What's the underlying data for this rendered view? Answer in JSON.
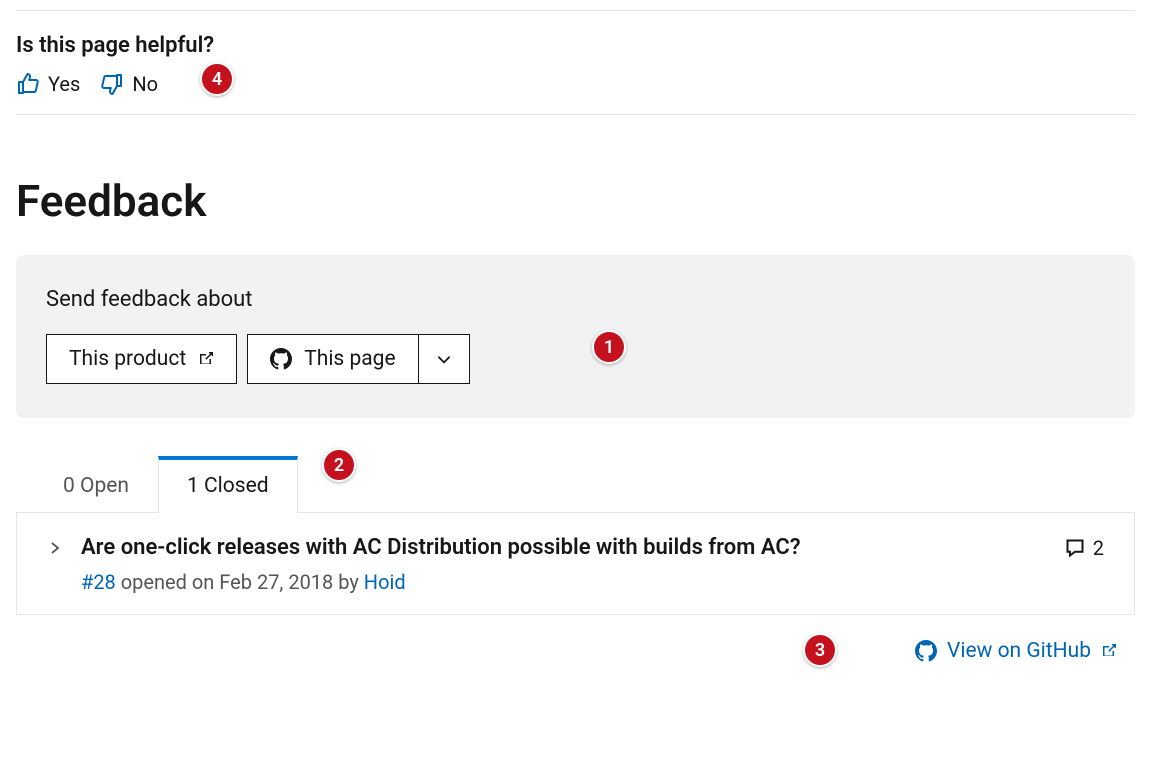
{
  "helpful": {
    "heading": "Is this page helpful?",
    "yes": "Yes",
    "no": "No"
  },
  "feedback_heading": "Feedback",
  "send_feedback": {
    "label": "Send feedback about",
    "product_btn": "This product",
    "page_btn": "This page"
  },
  "tabs": {
    "open": "0 Open",
    "closed": "1 Closed"
  },
  "issue": {
    "title": "Are one-click releases with AC Distribution possible with builds from AC?",
    "number": "#28",
    "opened_text": " opened on Feb 27, 2018 by ",
    "author": "Hoid",
    "comment_count": "2"
  },
  "footer": {
    "view_label": "View on GitHub"
  },
  "markers": {
    "m1": "1",
    "m2": "2",
    "m3": "3",
    "m4": "4"
  }
}
